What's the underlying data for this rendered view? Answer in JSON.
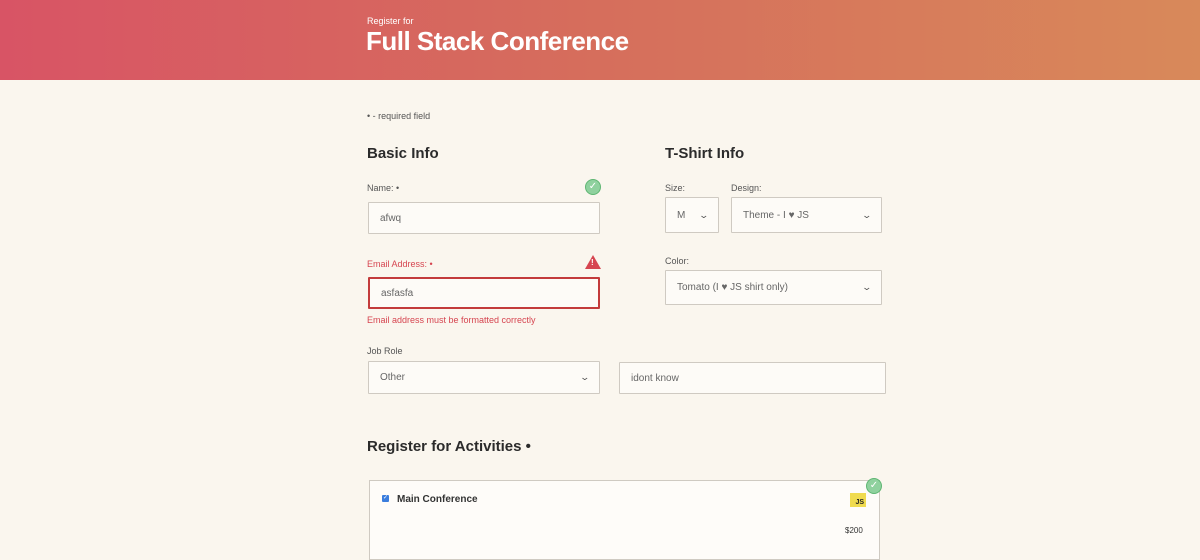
{
  "header": {
    "pre_title": "Register for",
    "title": "Full Stack Conference"
  },
  "required_note": "• - required field",
  "basic_info": {
    "heading": "Basic Info",
    "name": {
      "label": "Name: •",
      "value": "afwq",
      "status": "valid"
    },
    "email": {
      "label": "Email Address: •",
      "value": "asfasfa",
      "status": "error",
      "error_message": "Email address must be formatted correctly"
    },
    "job_role": {
      "label": "Job Role",
      "selected": "Other",
      "other_value": "idont know"
    }
  },
  "tshirt_info": {
    "heading": "T-Shirt Info",
    "size": {
      "label": "Size:",
      "selected": "M"
    },
    "design": {
      "label": "Design:",
      "selected": "Theme - I ♥ JS"
    },
    "color": {
      "label": "Color:",
      "selected": "Tomato (I ♥ JS shirt only)"
    }
  },
  "activities": {
    "heading": "Register for Activities •",
    "items": [
      {
        "label": "Main Conference",
        "checked": true,
        "badge": "JS",
        "price": "$200"
      }
    ]
  },
  "colors": {
    "header_start": "#d85465",
    "header_end": "#d8895a",
    "error": "#d64550",
    "valid": "#8fd19e",
    "checkbox": "#3b7ddd",
    "js_badge": "#f0db4f"
  }
}
